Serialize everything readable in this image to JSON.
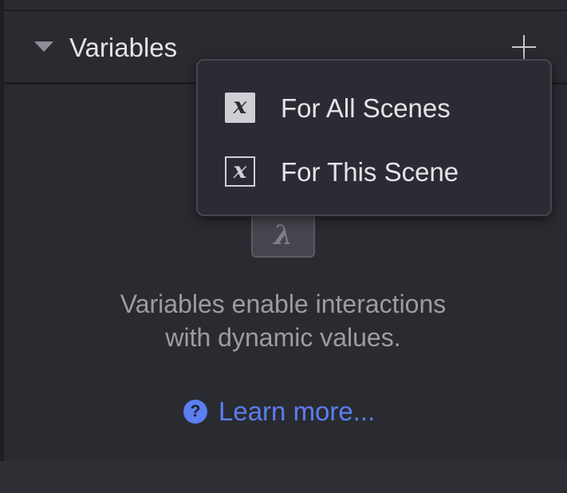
{
  "panel": {
    "title": "Variables",
    "add_icon": "plus-icon",
    "disclosure_icon": "triangle-down-icon"
  },
  "menu": {
    "items": [
      {
        "label": "For All Scenes",
        "icon": "variable-x-filled-icon",
        "icon_glyph": "x"
      },
      {
        "label": "For This Scene",
        "icon": "variable-x-outlined-icon",
        "icon_glyph": "x"
      }
    ]
  },
  "empty_state": {
    "icon": "lambda-icon",
    "icon_glyph": "λ",
    "line1": "Variables enable interactions",
    "line2": "with dynamic values."
  },
  "learn_more": {
    "icon": "help-circle-icon",
    "icon_glyph": "?",
    "label": "Learn more...",
    "color": "#5b7ef0"
  }
}
